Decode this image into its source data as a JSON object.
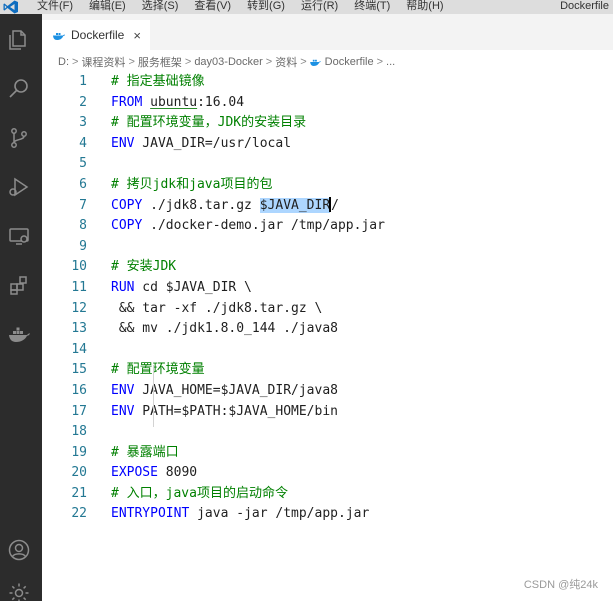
{
  "menubar": {
    "items": [
      "文件(F)",
      "编辑(E)",
      "选择(S)",
      "查看(V)",
      "转到(G)",
      "运行(R)",
      "终端(T)",
      "帮助(H)"
    ],
    "window_title": "Dockerfile"
  },
  "activity_bar": {
    "icons": [
      "explorer-icon",
      "search-icon",
      "source-control-icon",
      "run-debug-icon",
      "remote-explorer-icon",
      "extensions-icon",
      "docker-icon",
      "account-icon",
      "settings-gear-icon"
    ]
  },
  "tab": {
    "label": "Dockerfile",
    "close": "×"
  },
  "breadcrumb": {
    "parts": [
      "D:",
      "课程资料",
      "服务框架",
      "day03-Docker",
      "资料",
      "Dockerfile",
      "..."
    ],
    "separator": ">"
  },
  "code": {
    "line_numbers": [
      "1",
      "2",
      "3",
      "4",
      "5",
      "6",
      "7",
      "8",
      "9",
      "10",
      "11",
      "12",
      "13",
      "14",
      "15",
      "16",
      "17",
      "18",
      "19",
      "20",
      "21",
      "22"
    ],
    "l1": "# 指定基础镜像",
    "l2_kw": "FROM",
    "l2_a": " ",
    "l2_b": "ubuntu",
    "l2_c": ":16.04",
    "l3": "# 配置环境变量，JDK的安装目录",
    "l4_kw": "ENV",
    "l4_rest": " JAVA_DIR=/usr/local",
    "l6": "# 拷贝jdk和java项目的包",
    "l7_kw": "COPY",
    "l7_a": " ./jdk8.tar.gz ",
    "l7_b": "$JAVA_DIR",
    "l7_c": "/",
    "l8_kw": "COPY",
    "l8_rest": " ./docker-demo.jar /tmp/app.jar",
    "l10": "# 安装JDK",
    "l11_kw": "RUN",
    "l11_rest": " cd $JAVA_DIR \\",
    "l12": " && tar -xf ./jdk8.tar.gz \\",
    "l13": " && mv ./jdk1.8.0_144 ./java8",
    "l15": "# 配置环境变量",
    "l16_kw": "ENV",
    "l16_rest": " JAVA_HOME=$JAVA_DIR/java8",
    "l17_kw": "ENV",
    "l17_rest": " PATH=$PATH:$JAVA_HOME/bin",
    "l19": "# 暴露端口",
    "l20_kw": "EXPOSE",
    "l20_rest": " 8090",
    "l21": "# 入口，java项目的启动命令",
    "l22_kw": "ENTRYPOINT",
    "l22_rest": " java -jar /tmp/app.jar"
  },
  "watermark": "CSDN @纯24k",
  "colors": {
    "activity_bar": "#2c2c2c",
    "comment": "#008000",
    "keyword": "#0000ff",
    "line_number": "#237893",
    "selection": "#add6ff",
    "vscode_blue": "#0f6dbf"
  }
}
